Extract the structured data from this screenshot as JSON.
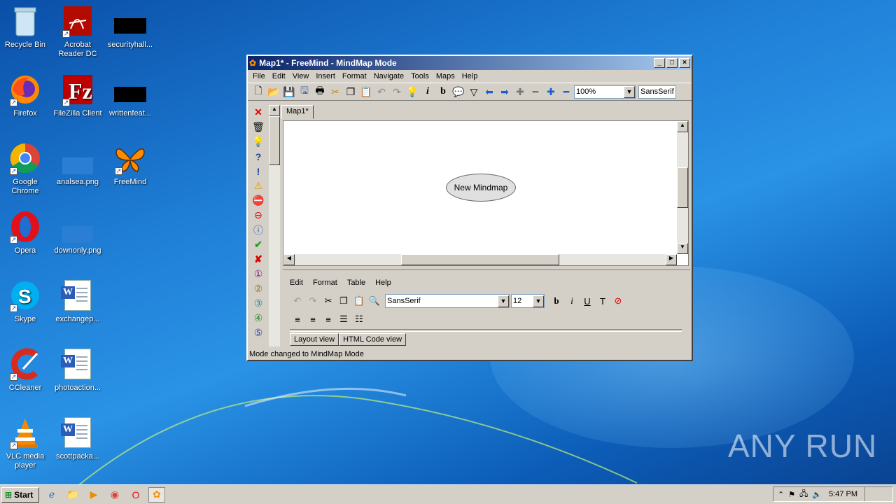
{
  "desktop": {
    "icons": [
      {
        "label": "Recycle Bin",
        "icon": "recycle-bin-icon"
      },
      {
        "label": "Acrobat Reader DC",
        "icon": "acrobat-icon"
      },
      {
        "label": "securityhall...",
        "icon": "file-icon"
      },
      {
        "label": "Firefox",
        "icon": "firefox-icon"
      },
      {
        "label": "FileZilla Client",
        "icon": "filezilla-icon"
      },
      {
        "label": "writtenfeat...",
        "icon": "file-icon"
      },
      {
        "label": "Google Chrome",
        "icon": "chrome-icon"
      },
      {
        "label": "analsea.png",
        "icon": "image-file-icon"
      },
      {
        "label": "FreeMind",
        "icon": "freemind-icon"
      },
      {
        "label": "Opera",
        "icon": "opera-icon"
      },
      {
        "label": "downonly.png",
        "icon": "image-file-icon"
      },
      {
        "label": "Skype",
        "icon": "skype-icon"
      },
      {
        "label": "exchangep...",
        "icon": "word-doc-icon"
      },
      {
        "label": "CCleaner",
        "icon": "ccleaner-icon"
      },
      {
        "label": "photoaction...",
        "icon": "word-doc-icon"
      },
      {
        "label": "VLC media player",
        "icon": "vlc-icon"
      },
      {
        "label": "scottpacka...",
        "icon": "word-doc-icon"
      }
    ],
    "watermark": "ANY RUN"
  },
  "window": {
    "title": "Map1* - FreeMind - MindMap Mode",
    "menu": [
      "File",
      "Edit",
      "View",
      "Insert",
      "Format",
      "Navigate",
      "Tools",
      "Maps",
      "Help"
    ],
    "zoom": "100%",
    "font": "SansSerif",
    "tab": "Map1*",
    "node": "New Mindmap",
    "notes": {
      "menu": [
        "Edit",
        "Format",
        "Table",
        "Help"
      ],
      "font": "SansSerif",
      "size": "12",
      "tabs": [
        "Layout view",
        "HTML Code view"
      ]
    },
    "status": "Mode changed to MindMap Mode"
  },
  "taskbar": {
    "start": "Start",
    "clock": "5:47 PM"
  }
}
